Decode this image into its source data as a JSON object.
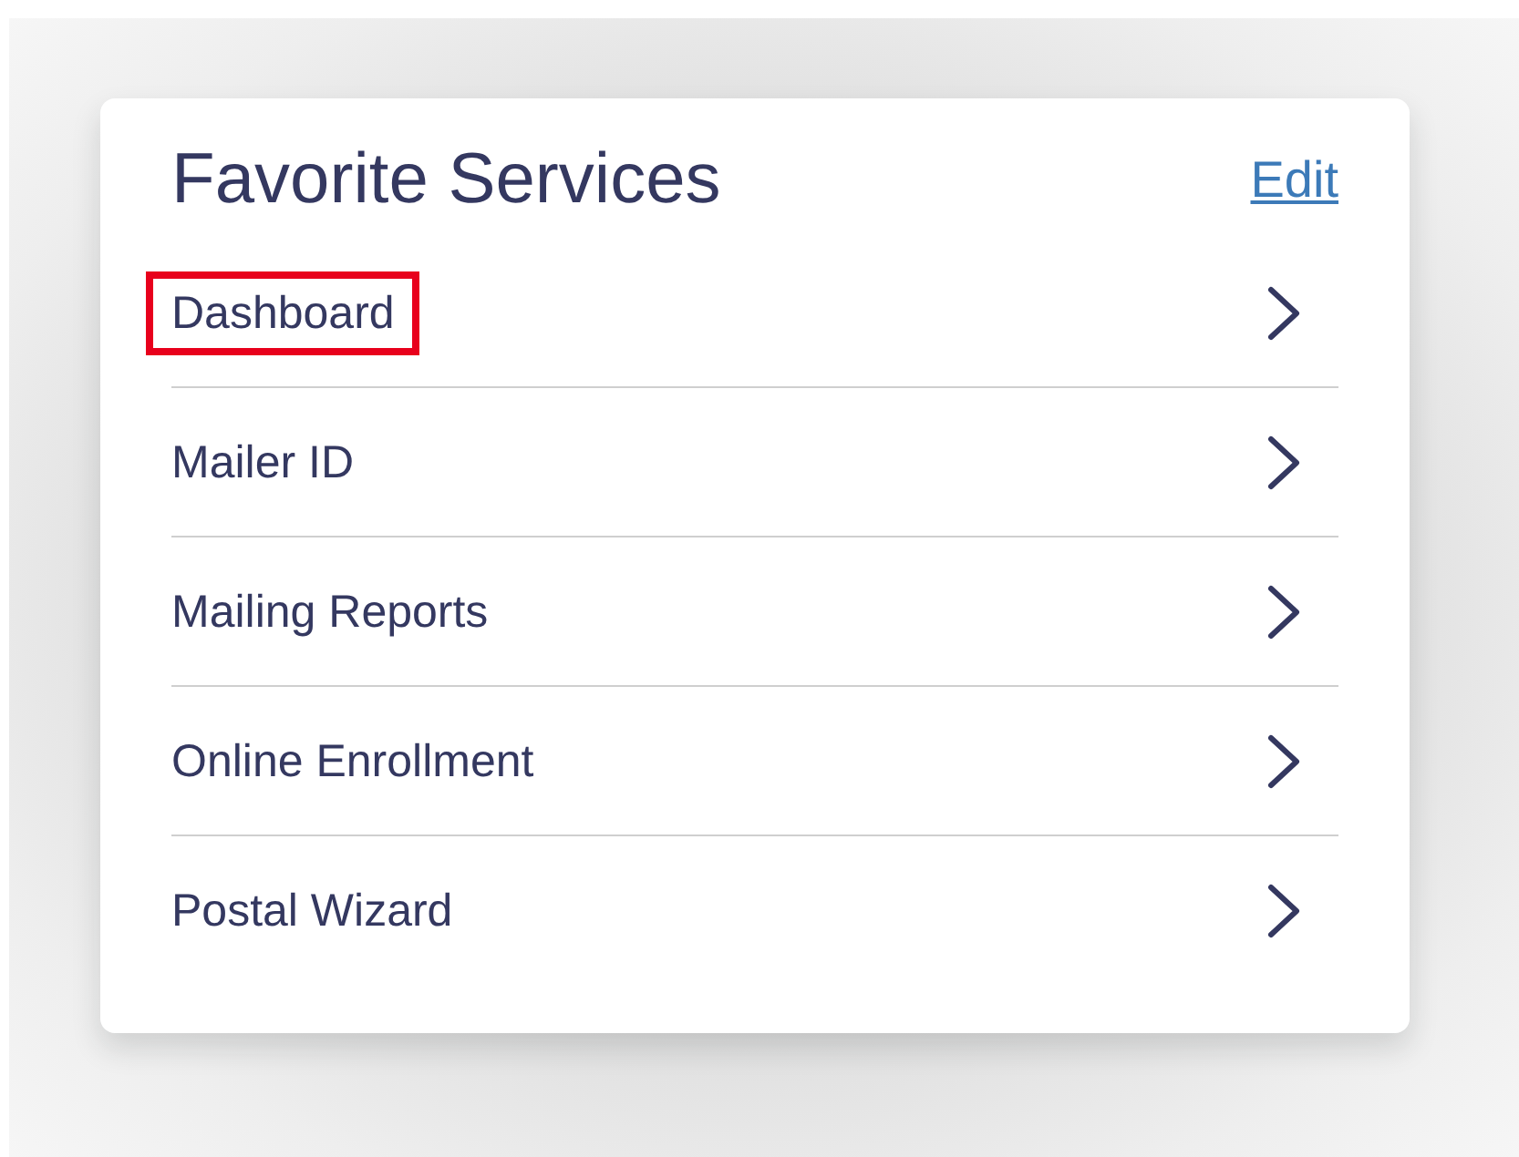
{
  "card": {
    "title": "Favorite Services",
    "edit_link": "Edit",
    "items": [
      {
        "label": "Dashboard",
        "highlighted": true
      },
      {
        "label": "Mailer ID",
        "highlighted": false
      },
      {
        "label": "Mailing Reports",
        "highlighted": false
      },
      {
        "label": "Online Enrollment",
        "highlighted": false
      },
      {
        "label": "Postal Wizard",
        "highlighted": false
      }
    ]
  }
}
